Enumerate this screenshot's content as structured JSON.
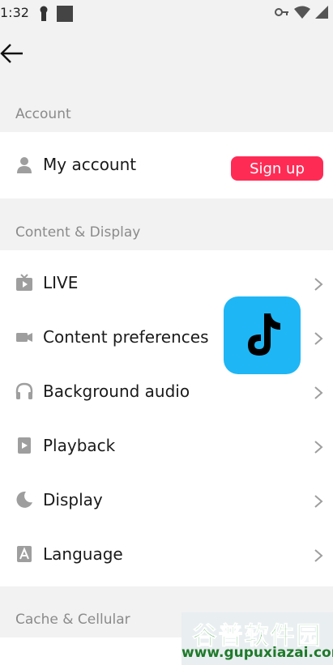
{
  "status_bar": {
    "time": "1:32",
    "left_icons": [
      "keyhole-icon",
      "square-icon"
    ],
    "right_icons": [
      "vpn-key-icon",
      "wifi-icon",
      "signal-icon"
    ]
  },
  "header": {
    "back_icon": "arrow-left-icon"
  },
  "sections": {
    "account": {
      "label": "Account",
      "my_account": {
        "label": "My account",
        "icon": "person-icon"
      },
      "sign_up_label": "Sign up"
    },
    "content_display": {
      "label": "Content & Display",
      "items": [
        {
          "label": "LIVE",
          "icon": "tv-icon"
        },
        {
          "label": "Content preferences",
          "icon": "video-camera-icon"
        },
        {
          "label": "Background audio",
          "icon": "headphones-icon"
        },
        {
          "label": "Playback",
          "icon": "play-box-icon"
        },
        {
          "label": "Display",
          "icon": "moon-icon"
        },
        {
          "label": "Language",
          "icon": "letter-a-icon"
        }
      ]
    },
    "cache_cellular": {
      "label": "Cache & Cellular"
    }
  },
  "overlay": {
    "logo_icon": "tiktok-logo-icon",
    "watermark_text": "谷普软件园",
    "watermark_url": "www.gupuxiazai.com"
  },
  "colors": {
    "accent": "#fe2c55",
    "background": "#f2f2f2",
    "card": "#ffffff",
    "section_text": "#8a8a8a",
    "icon_gray": "#9e9e9e",
    "logo_bg": "#1fb6f5"
  }
}
